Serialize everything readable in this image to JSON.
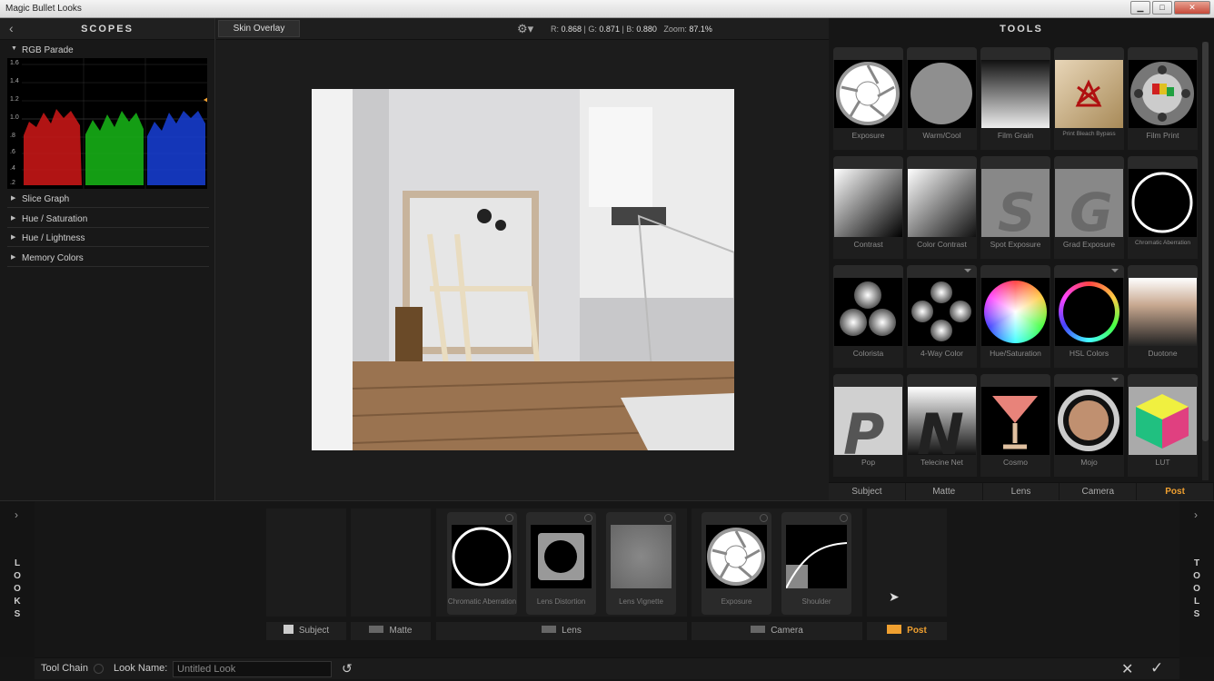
{
  "window": {
    "title": "Magic Bullet Looks",
    "minimize": "▁",
    "maximize": "□",
    "close": "✕"
  },
  "scopes": {
    "title": "SCOPES",
    "back_icon": "chevron-left-icon",
    "rgb_parade": "RGB Parade",
    "scale": [
      "1.6",
      "1.4",
      "1.2",
      "1.0",
      ".8",
      ".6",
      ".4",
      ".2",
      "0"
    ],
    "sections": [
      "Slice Graph",
      "Hue / Saturation",
      "Hue / Lightness",
      "Memory Colors"
    ]
  },
  "viewer": {
    "skin_overlay": "Skin Overlay",
    "readout": {
      "r_label": "R:",
      "r": "0.868",
      "g_label": "G:",
      "g": "0.871",
      "b_label": "B:",
      "b": "0.880",
      "zoom_label": "Zoom:",
      "zoom": "87.1%"
    }
  },
  "tools": {
    "title": "TOOLS",
    "items": [
      "Exposure",
      "Warm/Cool",
      "Film Grain",
      "Print Bleach Bypass",
      "Film Print",
      "Contrast",
      "Color Contrast",
      "Spot Exposure",
      "Grad Exposure",
      "Chromatic Aberration",
      "Colorista",
      "4-Way Color",
      "Hue/Saturation",
      "HSL Colors",
      "Duotone",
      "Pop",
      "Telecine Net",
      "Cosmo",
      "Mojo",
      "LUT"
    ],
    "tabs": [
      "Subject",
      "Matte",
      "Lens",
      "Camera",
      "Post"
    ],
    "active_tab": "Post"
  },
  "chain": {
    "looks_letters": "L O O K S",
    "tools_letters": "T O O L S",
    "tiles": [
      "Chromatic Aberration",
      "Lens Distortion",
      "Lens Vignette",
      "Exposure",
      "Shoulder"
    ],
    "labels": [
      "Subject",
      "Matte",
      "Lens",
      "Camera",
      "Post"
    ],
    "active_label": "Post"
  },
  "footer": {
    "tool_chain": "Tool Chain",
    "look_name_label": "Look Name:",
    "look_name_value": "Untitled Look",
    "reset_icon": "↺",
    "cancel_icon": "✕",
    "ok_icon": "✓"
  },
  "colors": {
    "accent": "#f0a030",
    "panel": "#161616",
    "red": "#e02020",
    "green": "#20c020",
    "blue": "#2050e0"
  }
}
